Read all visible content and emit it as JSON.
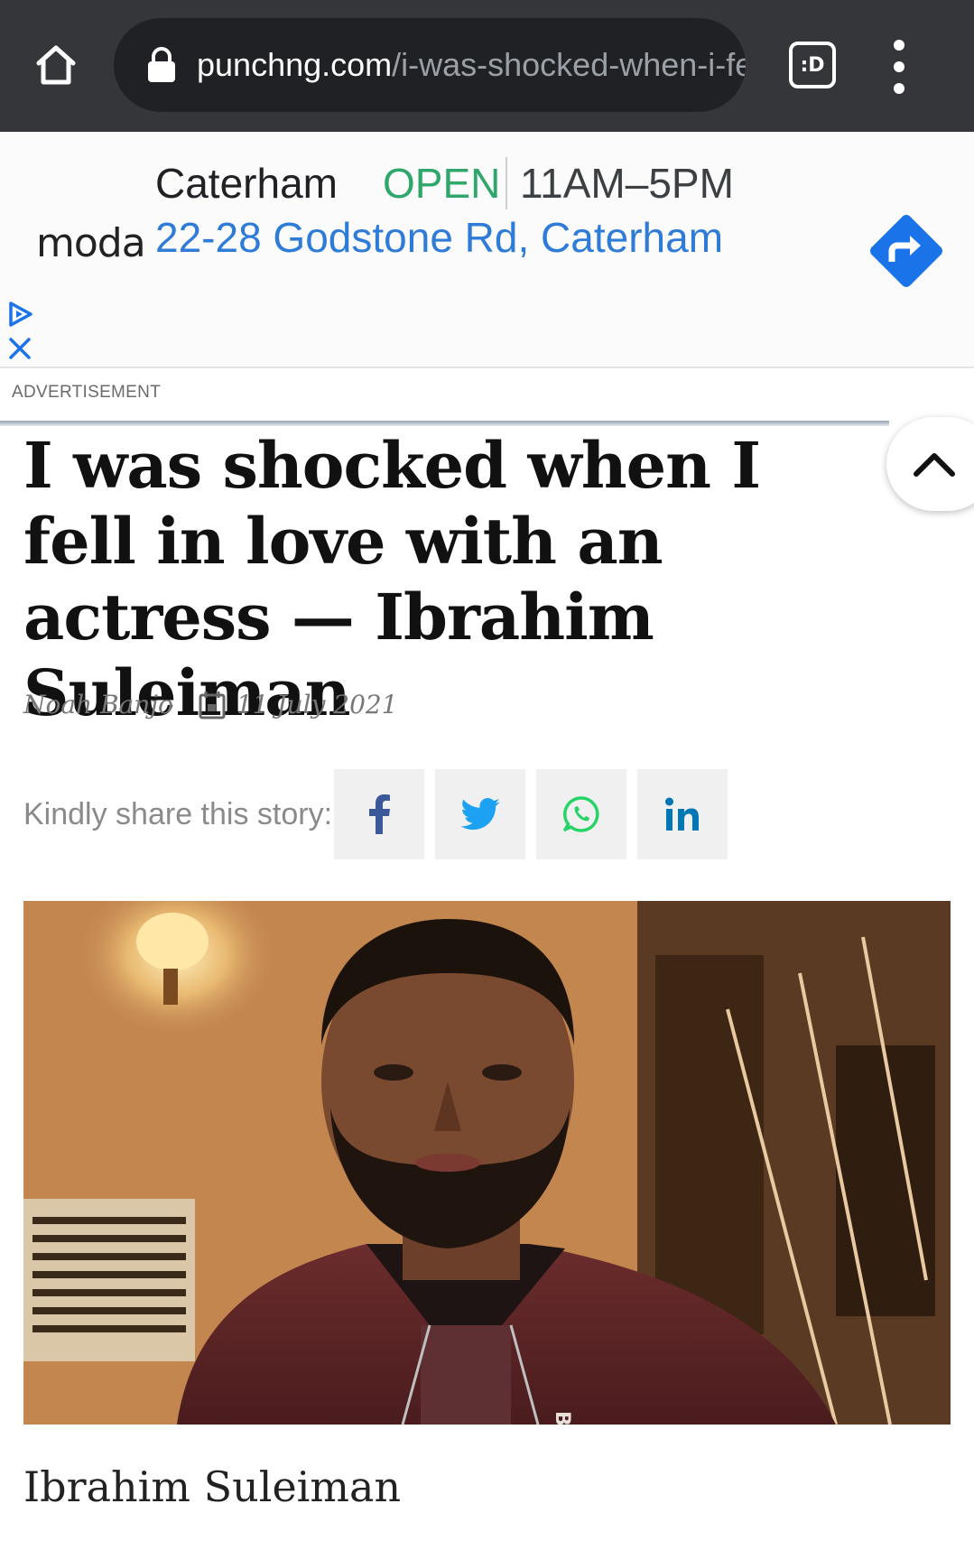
{
  "browser": {
    "url_host": "punchng.com",
    "url_path": "/i-was-shocked-when-i-fe",
    "tabs_label": ":D"
  },
  "ad": {
    "logo": "moda",
    "name": "Caterham",
    "status": "OPEN",
    "hours": "11AM–5PM",
    "address": "22-28 Godstone Rd, Caterham",
    "label": "ADVERTISEMENT"
  },
  "article": {
    "headline": "I was shocked when I fell in love with an actress — Ibrahim Suleiman",
    "author": "Noah Banjo",
    "date": "11 July 2021",
    "share_label": "Kindly share this story:",
    "image_caption": "Ibrahim Suleiman",
    "jacket_text": "BR"
  },
  "colors": {
    "topbar": "#35363a",
    "ad_open": "#2fa76b",
    "ad_link": "#2f7bd8",
    "facebook": "#3b5998",
    "twitter": "#1da1f2",
    "whatsapp": "#25d366",
    "linkedin": "#0077b5"
  }
}
